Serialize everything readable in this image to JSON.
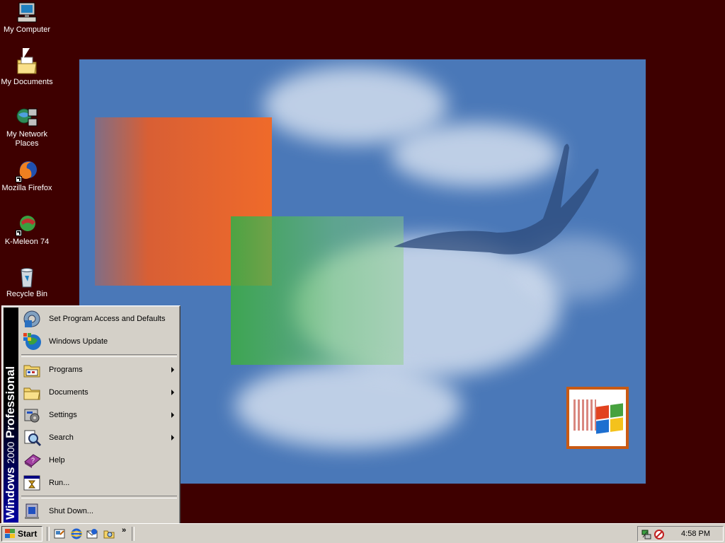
{
  "desktop": {
    "icons": [
      {
        "label": "My Computer"
      },
      {
        "label": "My Documents"
      },
      {
        "label": "My Network Places"
      },
      {
        "label": "Mozilla Firefox"
      },
      {
        "label": "K-Meleon 74"
      },
      {
        "label": "Recycle Bin"
      }
    ]
  },
  "start_menu": {
    "banner_brand": "Windows",
    "banner_version": "2000",
    "banner_edition": "Professional",
    "items": [
      {
        "label": "Set Program Access and Defaults",
        "icon": "program-access-icon",
        "submenu": false
      },
      {
        "label": "Windows Update",
        "icon": "windows-update-icon",
        "submenu": false
      },
      {
        "label": "Programs",
        "icon": "programs-icon",
        "submenu": true
      },
      {
        "label": "Documents",
        "icon": "documents-icon",
        "submenu": true
      },
      {
        "label": "Settings",
        "icon": "settings-icon",
        "submenu": true
      },
      {
        "label": "Search",
        "icon": "search-icon",
        "submenu": true
      },
      {
        "label": "Help",
        "icon": "help-icon",
        "submenu": false
      },
      {
        "label": "Run...",
        "icon": "run-icon",
        "submenu": false
      },
      {
        "label": "Shut Down...",
        "icon": "shutdown-icon",
        "submenu": false
      }
    ]
  },
  "taskbar": {
    "start_label": "Start",
    "quick_launch_more": "»",
    "clock": "4:58 PM"
  },
  "colors": {
    "desktop_bg": "#3e0000",
    "face": "#d4d0c8",
    "wallpaper_sky": "#4a78b8"
  }
}
